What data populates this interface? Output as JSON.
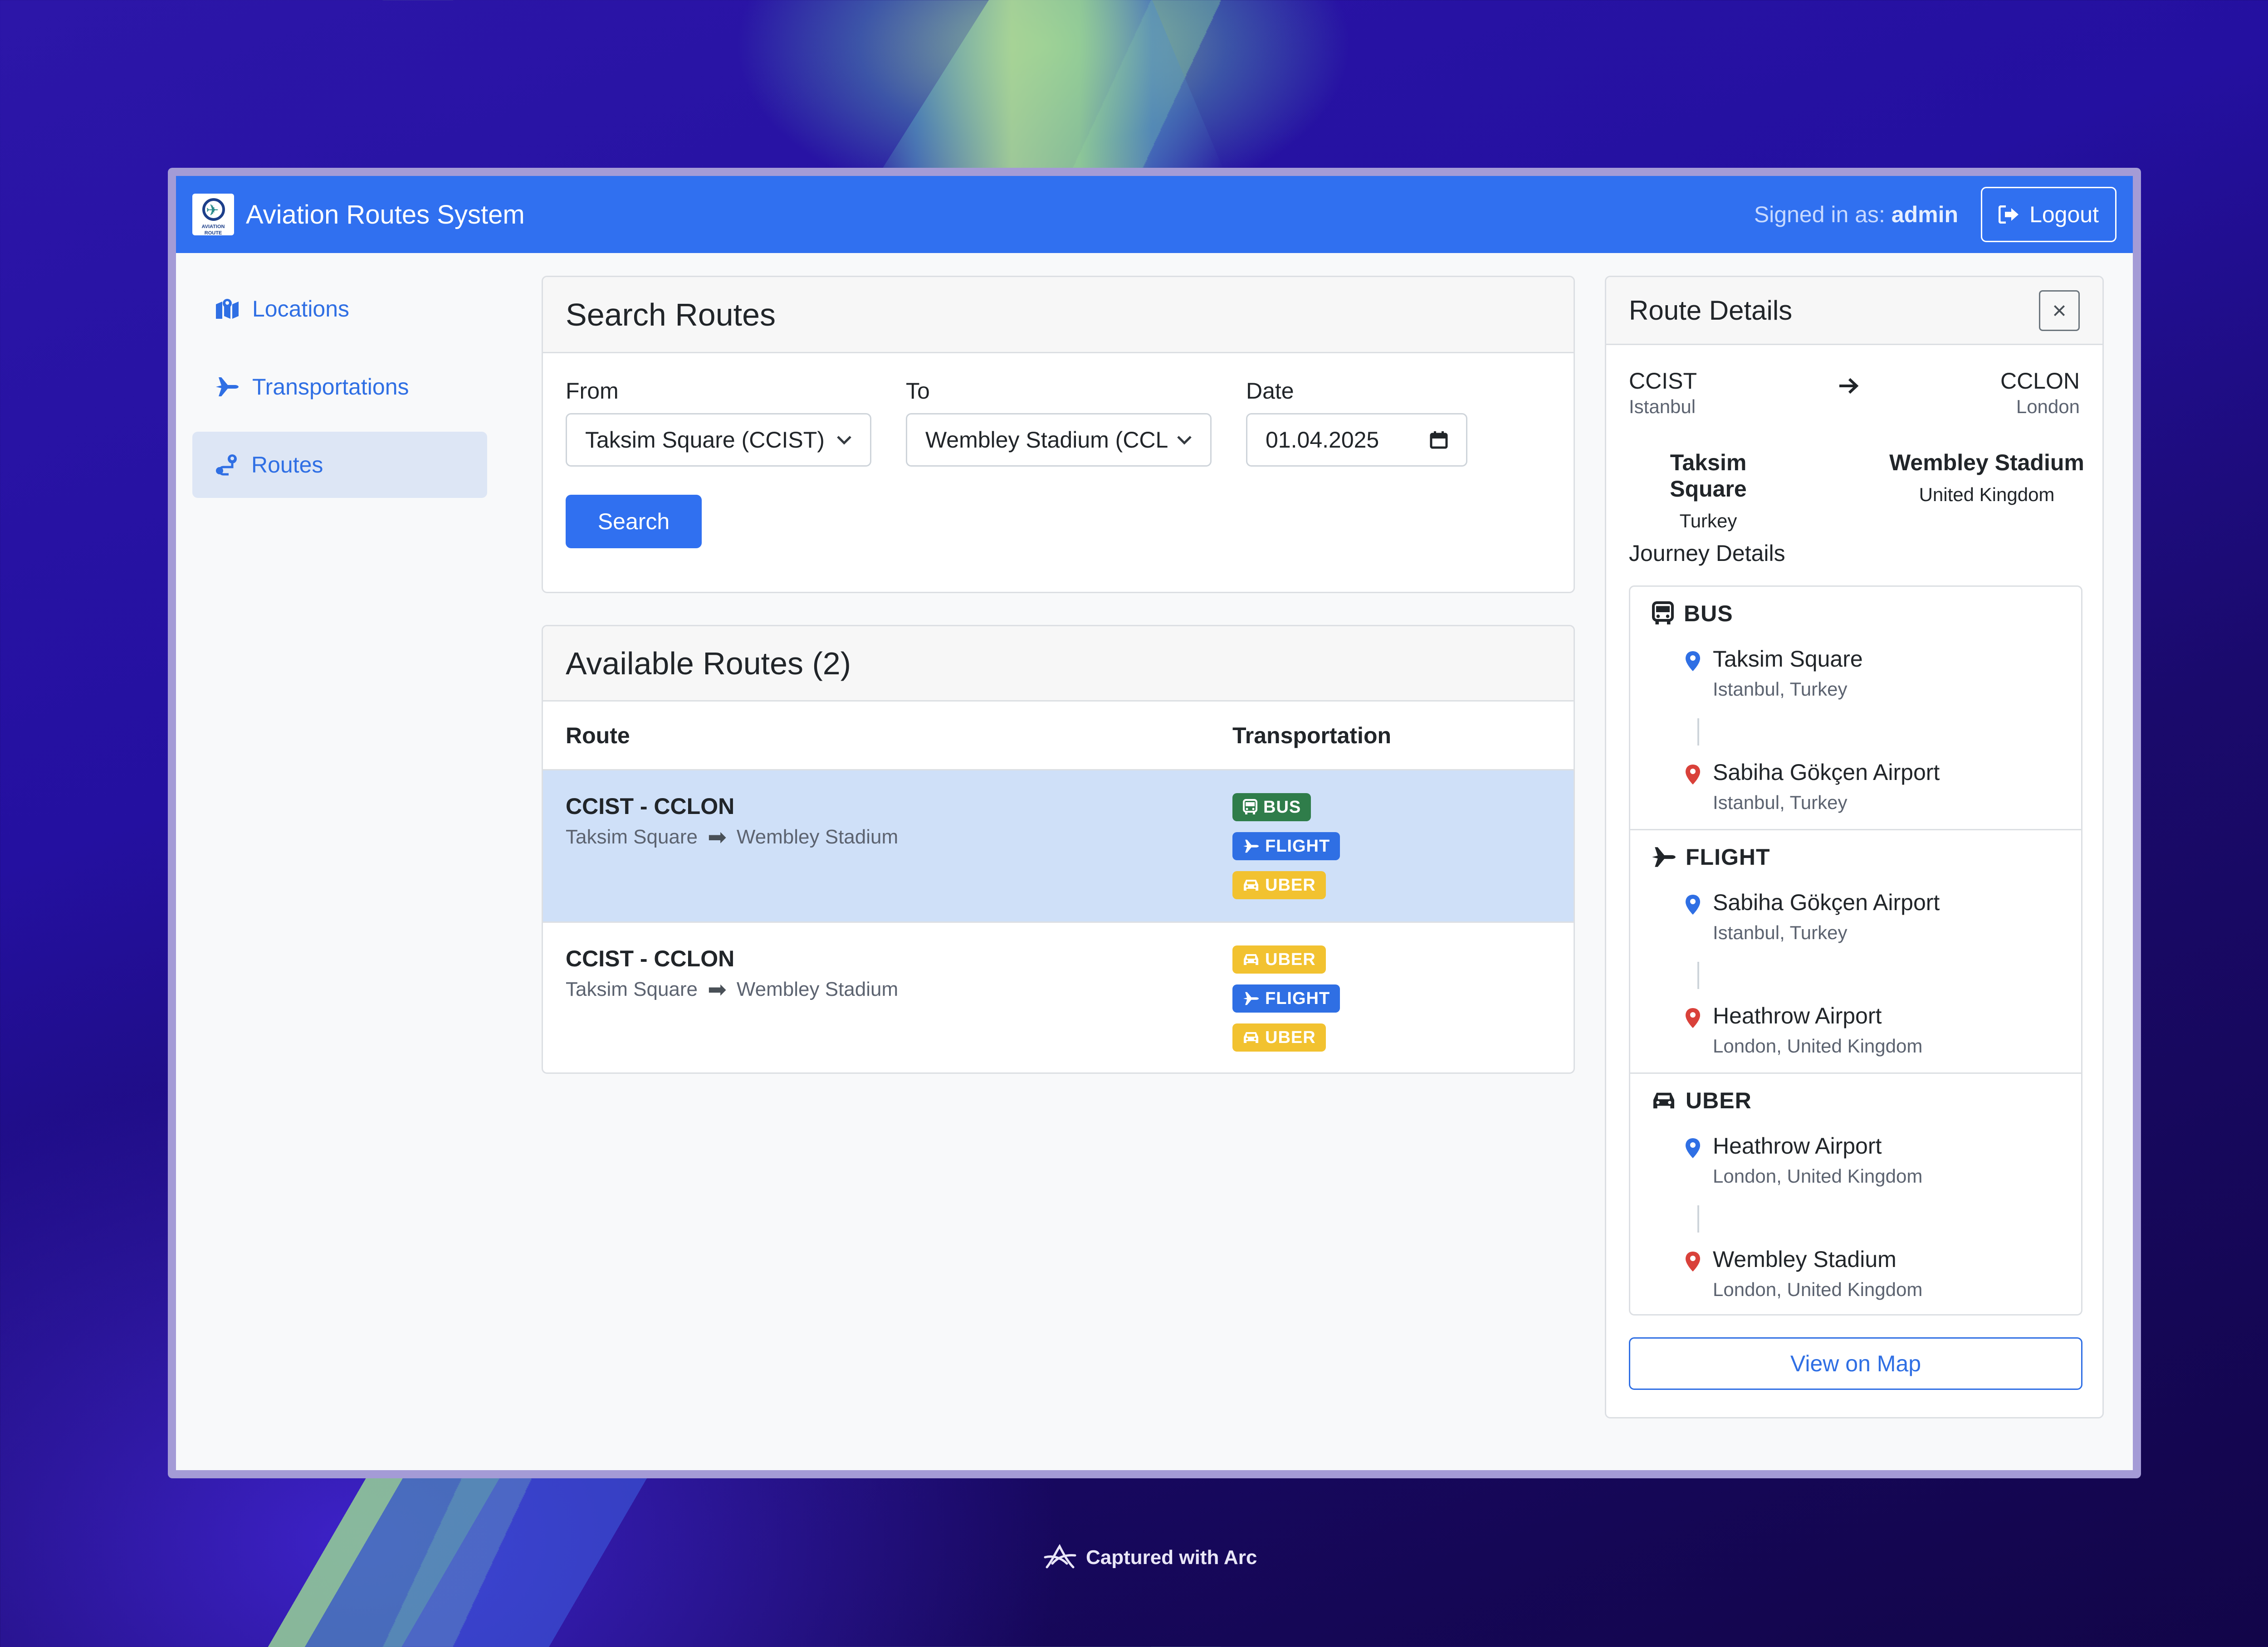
{
  "app": {
    "title": "Aviation Routes System",
    "logo_text": "AVIATION ROUTE",
    "signed_in_label": "Signed in as:",
    "user": "admin",
    "logout_label": "Logout"
  },
  "sidebar": {
    "items": [
      {
        "label": "Locations",
        "icon": "map-icon"
      },
      {
        "label": "Transportations",
        "icon": "plane-icon"
      },
      {
        "label": "Routes",
        "icon": "route-icon",
        "active": true
      }
    ]
  },
  "search": {
    "title": "Search Routes",
    "from_label": "From",
    "from_value": "Taksim Square (CCIST)",
    "to_label": "To",
    "to_value": "Wembley Stadium (CCL",
    "date_label": "Date",
    "date_value": "01.04.2025",
    "button_label": "Search"
  },
  "results": {
    "title": "Available Routes (2)",
    "col_route": "Route",
    "col_transportation": "Transportation",
    "rows": [
      {
        "code": "CCIST - CCLON",
        "origin": "Taksim Square",
        "destination": "Wembley Stadium",
        "badges": [
          "BUS",
          "FLIGHT",
          "UBER"
        ],
        "selected": true
      },
      {
        "code": "CCIST - CCLON",
        "origin": "Taksim Square",
        "destination": "Wembley Stadium",
        "badges": [
          "UBER",
          "FLIGHT",
          "UBER"
        ],
        "selected": false
      }
    ]
  },
  "details": {
    "title": "Route Details",
    "close_symbol": "×",
    "origin_code": "CCIST",
    "origin_city": "Istanbul",
    "dest_code": "CCLON",
    "dest_city": "London",
    "origin_place": "Taksim Square",
    "origin_country": "Turkey",
    "dest_place": "Wembley Stadium",
    "dest_country": "United Kingdom",
    "journey_title": "Journey Details",
    "segments": [
      {
        "type": "BUS",
        "from_name": "Taksim Square",
        "from_loc": "Istanbul, Turkey",
        "to_name": "Sabiha Gökçen Airport",
        "to_loc": "Istanbul, Turkey"
      },
      {
        "type": "FLIGHT",
        "from_name": "Sabiha Gökçen Airport",
        "from_loc": "Istanbul, Turkey",
        "to_name": "Heathrow Airport",
        "to_loc": "London, United Kingdom"
      },
      {
        "type": "UBER",
        "from_name": "Heathrow Airport",
        "from_loc": "London, United Kingdom",
        "to_name": "Wembley Stadium",
        "to_loc": "London, United Kingdom"
      }
    ],
    "map_button": "View on Map"
  },
  "footer": {
    "captured": "Captured with Arc"
  },
  "colors": {
    "primary": "#3070f0",
    "bus": "#2f7d4a",
    "flight": "#2f6fe4",
    "uber": "#f2c230",
    "pin_start": "#2f6fe4",
    "pin_end": "#d9413a"
  }
}
